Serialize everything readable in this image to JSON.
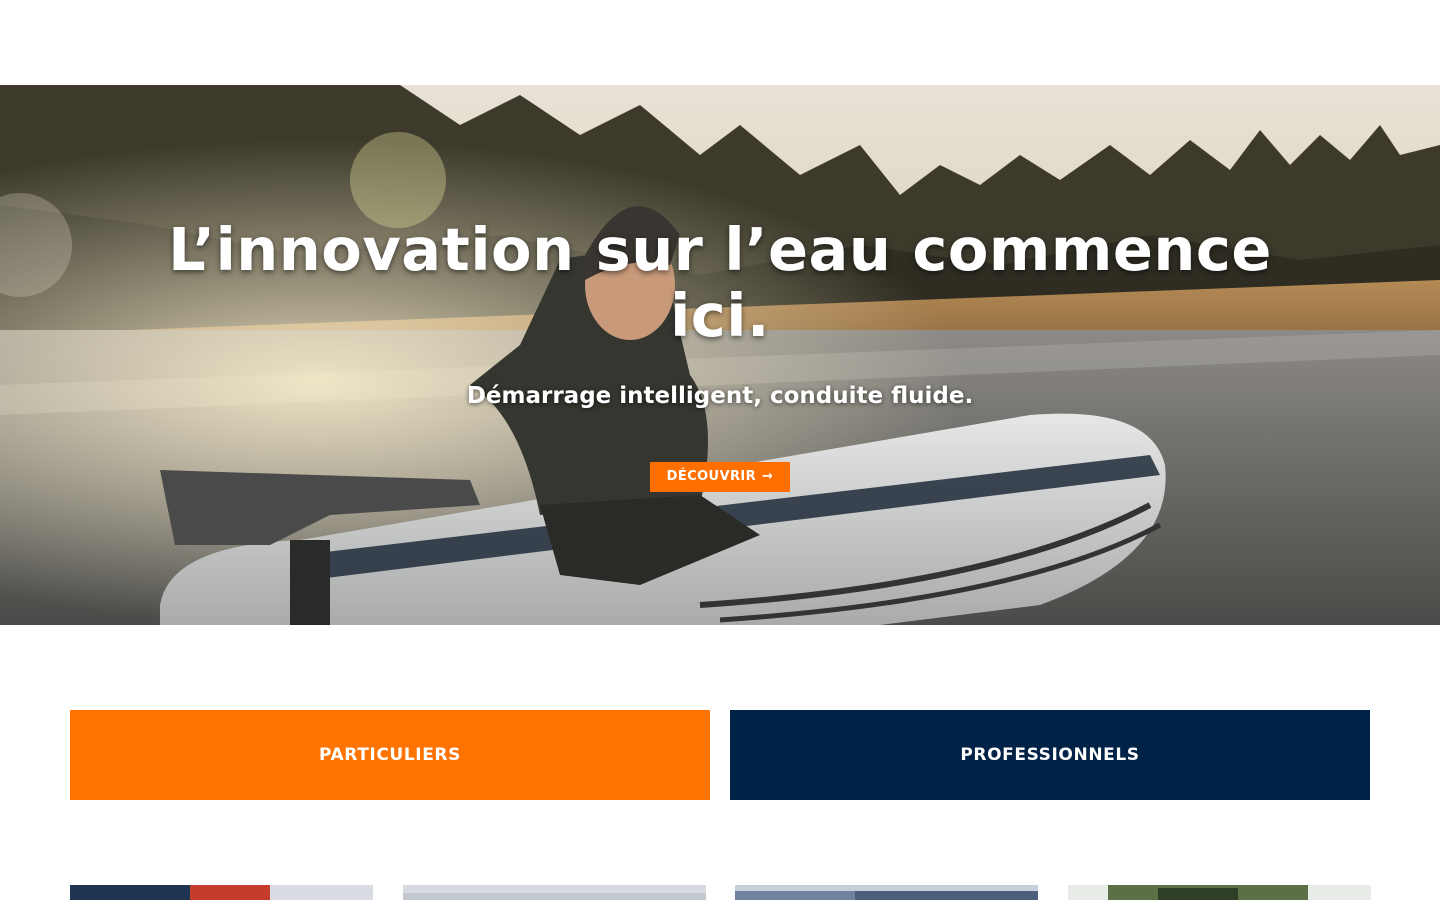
{
  "hero": {
    "title": "L’innovation sur l’eau commence ici.",
    "subtitle": "Démarrage intelligent, conduite fluide.",
    "cta_label": "DÉCOUVRIR",
    "cta_icon": "arrow-right-icon",
    "cta_color": "#ff6f00",
    "photo_subject": "man-on-inflatable-boat-with-electric-outboard"
  },
  "segments": {
    "private_label": "PARTICULIERS",
    "private_color": "#ff7300",
    "pro_label": "PROFESSIONNELS",
    "pro_color": "#012247"
  },
  "cards": [
    {
      "name": "card-1"
    },
    {
      "name": "card-2"
    },
    {
      "name": "card-3"
    },
    {
      "name": "card-4"
    }
  ]
}
